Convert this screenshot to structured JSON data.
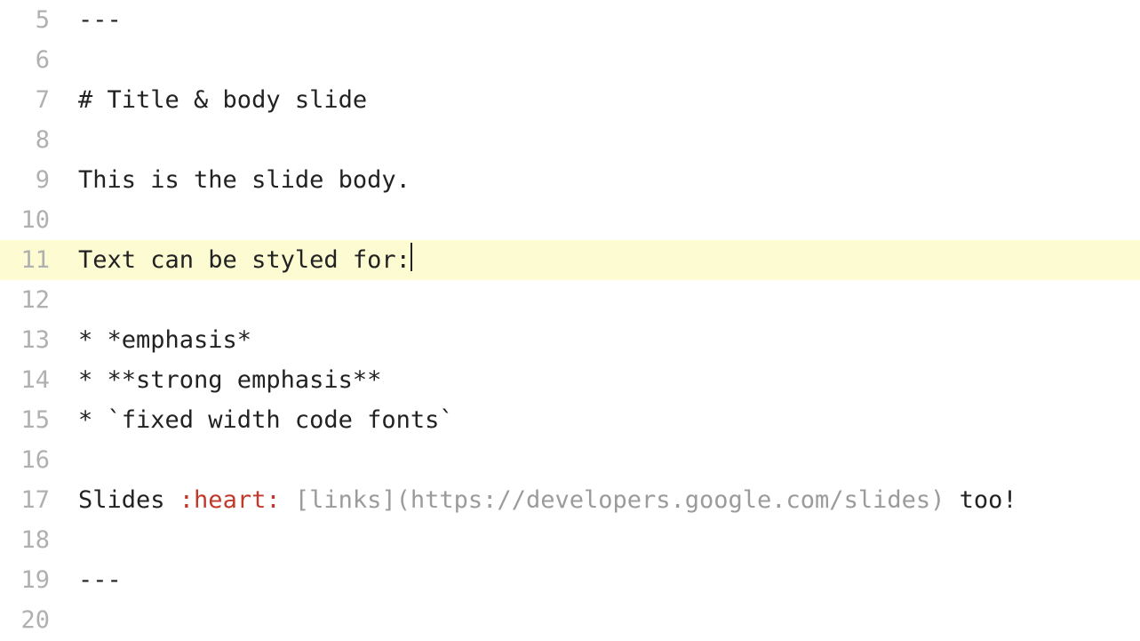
{
  "editor": {
    "activeLine": 11,
    "lines": [
      {
        "num": 5,
        "segments": [
          {
            "text": "---"
          }
        ]
      },
      {
        "num": 6,
        "segments": []
      },
      {
        "num": 7,
        "segments": [
          {
            "text": "# Title & body slide"
          }
        ]
      },
      {
        "num": 8,
        "segments": []
      },
      {
        "num": 9,
        "segments": [
          {
            "text": "This is the slide body."
          }
        ]
      },
      {
        "num": 10,
        "segments": []
      },
      {
        "num": 11,
        "segments": [
          {
            "text": "Text can be styled for:"
          }
        ],
        "cursor": true
      },
      {
        "num": 12,
        "segments": []
      },
      {
        "num": 13,
        "segments": [
          {
            "text": "* *emphasis*"
          }
        ]
      },
      {
        "num": 14,
        "segments": [
          {
            "text": "* **strong emphasis**"
          }
        ]
      },
      {
        "num": 15,
        "segments": [
          {
            "text": "* `fixed width code fonts`"
          }
        ]
      },
      {
        "num": 16,
        "segments": []
      },
      {
        "num": 17,
        "segments": [
          {
            "text": "Slides "
          },
          {
            "text": ":heart:",
            "cls": "emoji"
          },
          {
            "text": " "
          },
          {
            "text": "[links](https://developers.google.com/slides)",
            "cls": "linkish"
          },
          {
            "text": " too!"
          }
        ]
      },
      {
        "num": 18,
        "segments": []
      },
      {
        "num": 19,
        "segments": [
          {
            "text": "---"
          }
        ]
      },
      {
        "num": 20,
        "segments": []
      }
    ]
  }
}
